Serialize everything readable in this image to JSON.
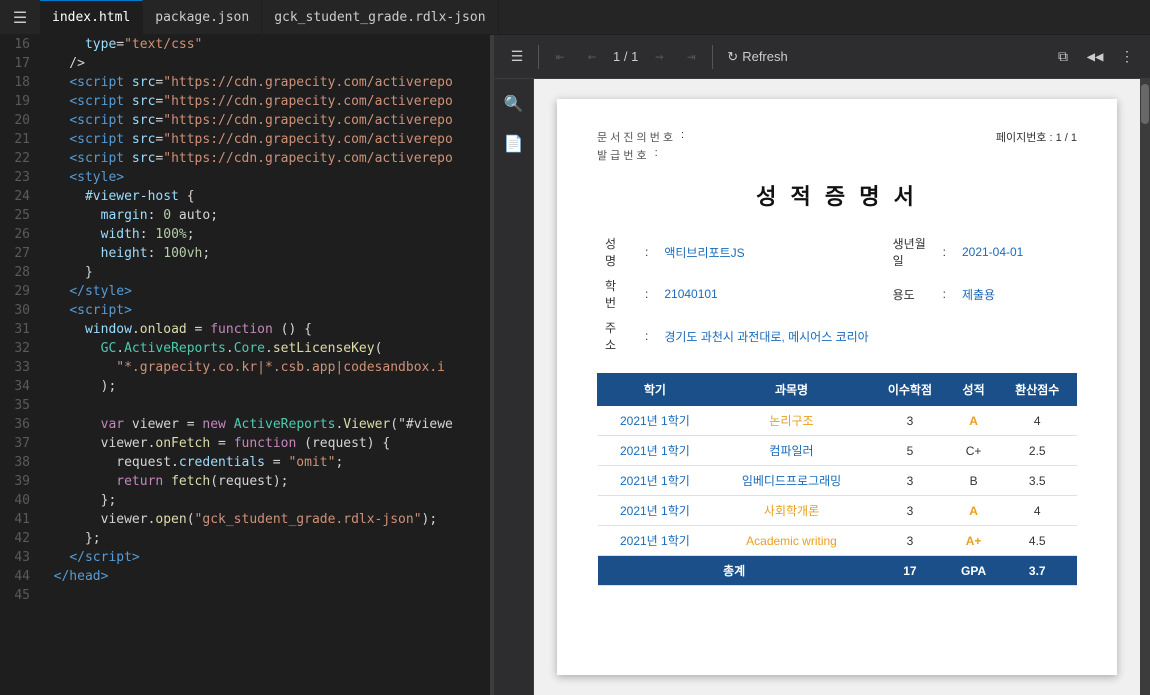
{
  "tabs": [
    {
      "id": "index",
      "label": "index.html",
      "active": true
    },
    {
      "id": "package",
      "label": "package.json",
      "active": false
    },
    {
      "id": "gck",
      "label": "gck_student_grade.rdlx-json",
      "active": false
    }
  ],
  "toolbar": {
    "refresh_label": "Refresh",
    "page_info": "1 / 1"
  },
  "code": {
    "lines": [
      {
        "num": "16",
        "html": "<span class='tok-attr'>      type</span><span class='tok-white'>=</span><span class='tok-val'>\"text/css\"</span>"
      },
      {
        "num": "17",
        "html": "<span class='tok-white'>    /></span>"
      },
      {
        "num": "18",
        "html": "<span class='tok-white'>    </span><span class='tok-tag'>&lt;script</span><span class='tok-attr'> src</span><span class='tok-white'>=</span><span class='tok-val'>\"https://cdn.grapecity.com/activerepo</span>"
      },
      {
        "num": "19",
        "html": "<span class='tok-white'>    </span><span class='tok-tag'>&lt;script</span><span class='tok-attr'> src</span><span class='tok-white'>=</span><span class='tok-val'>\"https://cdn.grapecity.com/activerepo</span>"
      },
      {
        "num": "20",
        "html": "<span class='tok-white'>    </span><span class='tok-tag'>&lt;script</span><span class='tok-attr'> src</span><span class='tok-white'>=</span><span class='tok-val'>\"https://cdn.grapecity.com/activerepo</span>"
      },
      {
        "num": "21",
        "html": "<span class='tok-white'>    </span><span class='tok-tag'>&lt;script</span><span class='tok-attr'> src</span><span class='tok-white'>=</span><span class='tok-val'>\"https://cdn.grapecity.com/activerepo</span>"
      },
      {
        "num": "22",
        "html": "<span class='tok-white'>    </span><span class='tok-tag'>&lt;script</span><span class='tok-attr'> src</span><span class='tok-white'>=</span><span class='tok-val'>\"https://cdn.grapecity.com/activerepo</span>"
      },
      {
        "num": "23",
        "html": "<span class='tok-white'>    </span><span class='tok-tag'>&lt;style&gt;</span>"
      },
      {
        "num": "24",
        "html": "<span class='tok-white'>      </span><span class='tok-prop'>#viewer-host</span><span class='tok-white'> {</span>"
      },
      {
        "num": "25",
        "html": "<span class='tok-white'>        </span><span class='tok-prop'>margin</span><span class='tok-white'>: </span><span class='tok-num'>0</span><span class='tok-white'> auto;</span>"
      },
      {
        "num": "26",
        "html": "<span class='tok-white'>        </span><span class='tok-prop'>width</span><span class='tok-white'>: </span><span class='tok-num'>100%</span><span class='tok-white'>;</span>"
      },
      {
        "num": "27",
        "html": "<span class='tok-white'>        </span><span class='tok-prop'>height</span><span class='tok-white'>: </span><span class='tok-num'>100vh</span><span class='tok-white'>;</span>"
      },
      {
        "num": "28",
        "html": "<span class='tok-white'>      }</span>"
      },
      {
        "num": "29",
        "html": "<span class='tok-white'>    </span><span class='tok-tag'>&lt;/style&gt;</span>"
      },
      {
        "num": "30",
        "html": "<span class='tok-white'>    </span><span class='tok-tag'>&lt;script&gt;</span>"
      },
      {
        "num": "31",
        "html": "<span class='tok-white'>      </span><span class='tok-prop'>window</span><span class='tok-white'>.</span><span class='tok-fn'>onload</span><span class='tok-white'> = </span><span class='tok-keyword'>function</span><span class='tok-white'> () {</span>"
      },
      {
        "num": "32",
        "html": "<span class='tok-white'>        </span><span class='tok-obj'>GC</span><span class='tok-white'>.</span><span class='tok-obj'>ActiveReports</span><span class='tok-white'>.</span><span class='tok-obj'>Core</span><span class='tok-white'>.</span><span class='tok-fn'>setLicenseKey</span><span class='tok-white'>(</span>"
      },
      {
        "num": "33",
        "html": "<span class='tok-white'>          </span><span class='tok-val'>\"*.grapecity.co.kr|*.csb.app|codesandbox.i</span>"
      },
      {
        "num": "34",
        "html": "<span class='tok-white'>        );</span>"
      },
      {
        "num": "35",
        "html": ""
      },
      {
        "num": "36",
        "html": "<span class='tok-white'>        </span><span class='tok-keyword'>var</span><span class='tok-white'> viewer = </span><span class='tok-keyword'>new</span><span class='tok-white'> </span><span class='tok-obj'>ActiveReports</span><span class='tok-white'>.</span><span class='tok-fn'>Viewer</span><span class='tok-white'>(\"#viewe</span>"
      },
      {
        "num": "37",
        "html": "<span class='tok-white'>        viewer.</span><span class='tok-fn'>onFetch</span><span class='tok-white'> = </span><span class='tok-keyword'>function</span><span class='tok-white'> (request) {</span>"
      },
      {
        "num": "38",
        "html": "<span class='tok-white'>          request.</span><span class='tok-prop'>credentials</span><span class='tok-white'> = </span><span class='tok-val'>\"omit\"</span><span class='tok-white'>;</span>"
      },
      {
        "num": "39",
        "html": "<span class='tok-white'>          </span><span class='tok-keyword'>return</span><span class='tok-white'> </span><span class='tok-fn'>fetch</span><span class='tok-white'>(request);</span>"
      },
      {
        "num": "40",
        "html": "<span class='tok-white'>        };</span>"
      },
      {
        "num": "41",
        "html": "<span class='tok-white'>        viewer.</span><span class='tok-fn'>open</span><span class='tok-white'>(</span><span class='tok-val'>\"gck_student_grade.rdlx-json\"</span><span class='tok-white'>);</span>"
      },
      {
        "num": "42",
        "html": "<span class='tok-white'>      };</span>"
      },
      {
        "num": "43",
        "html": "<span class='tok-white'>    </span><span class='tok-tag'>&lt;/script&gt;</span>"
      },
      {
        "num": "44",
        "html": "<span class='tok-white'>  </span><span class='tok-tag'>&lt;/head&gt;</span>"
      },
      {
        "num": "45",
        "html": ""
      }
    ]
  },
  "document": {
    "meta_left": [
      {
        "label": "문 서 진 의 번 호",
        "colon": ":",
        "value": ""
      },
      {
        "label": "발 급 번 호",
        "colon": ":",
        "value": ""
      }
    ],
    "meta_right": "페이지번호 :   1 / 1",
    "title": "성 적 증 명 서",
    "student_info": [
      {
        "label": "성 명",
        "value": "액티브리포트JS",
        "label2": "생년월일",
        "value2": "2021-04-01"
      },
      {
        "label": "학 번",
        "value": "21040101",
        "label2": "용도",
        "value2": "제출용"
      },
      {
        "label": "주 소",
        "value": "경기도 과천시 과전대로, 메시어스 코리아",
        "label2": "",
        "value2": ""
      }
    ],
    "table_headers": [
      "학기",
      "과목명",
      "이수학점",
      "성적",
      "환산점수"
    ],
    "table_rows": [
      {
        "term": "2021년 1학기",
        "subject": "논리구조",
        "credits": "3",
        "grade": "A",
        "points": "4"
      },
      {
        "term": "2021년 1학기",
        "subject": "컴파일러",
        "credits": "5",
        "grade": "C+",
        "points": "2.5"
      },
      {
        "term": "2021년 1학기",
        "subject": "임베디드프로그래밍",
        "credits": "3",
        "grade": "B",
        "points": "3.5"
      },
      {
        "term": "2021년 1학기",
        "subject": "사회학개론",
        "credits": "3",
        "grade": "A",
        "points": "4"
      },
      {
        "term": "2021년 1학기",
        "subject": "Academic writing",
        "credits": "3",
        "grade": "A+",
        "points": "4.5"
      }
    ],
    "total_row": {
      "label": "총계",
      "credits": "17",
      "grade_label": "GPA",
      "gpa": "3.7"
    }
  }
}
